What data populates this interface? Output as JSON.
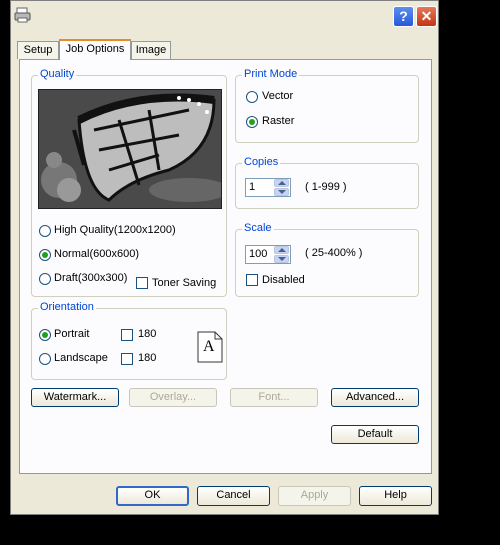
{
  "tabs": [
    {
      "label": "Setup"
    },
    {
      "label": "Job Options"
    },
    {
      "label": "Image"
    }
  ],
  "quality": {
    "legend": "Quality",
    "options": [
      {
        "label": "High Quality(1200x1200)",
        "selected": false
      },
      {
        "label": "Normal(600x600)",
        "selected": true
      },
      {
        "label": "Draft(300x300)",
        "selected": false
      }
    ],
    "toner_saving": {
      "label": "Toner Saving",
      "checked": false
    }
  },
  "orientation": {
    "legend": "Orientation",
    "portrait": {
      "label": "Portrait",
      "selected": true,
      "rotate_label": "180"
    },
    "landscape": {
      "label": "Landscape",
      "selected": false,
      "rotate_label": "180"
    },
    "preview_letter": "A"
  },
  "print_mode": {
    "legend": "Print Mode",
    "options": [
      {
        "label": "Vector",
        "selected": false
      },
      {
        "label": "Raster",
        "selected": true
      }
    ]
  },
  "copies": {
    "legend": "Copies",
    "value": "1",
    "range": "( 1-999 )"
  },
  "scale": {
    "legend": "Scale",
    "value": "100",
    "range": "( 25-400% )",
    "disabled": {
      "label": "Disabled",
      "checked": false
    }
  },
  "buttons": {
    "watermark": "Watermark...",
    "overlay": "Overlay...",
    "font": "Font...",
    "advanced": "Advanced...",
    "default": "Default"
  },
  "footer": {
    "ok": "OK",
    "cancel": "Cancel",
    "apply": "Apply",
    "help": "Help"
  },
  "titlebar": {
    "help": "?",
    "close": "✕"
  }
}
